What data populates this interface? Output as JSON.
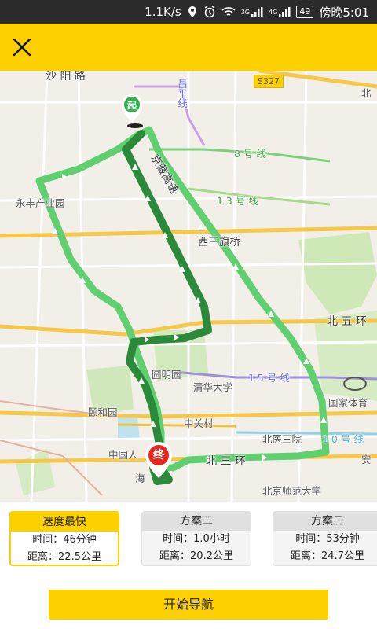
{
  "status_bar": {
    "net_speed": "1.1K/s",
    "battery": "49",
    "time": "傍晚5:01",
    "signal_a": "3G",
    "signal_b": "4G"
  },
  "header": {
    "close_icon": "close-icon"
  },
  "map": {
    "labels": {
      "shayang": "沙 阳 路",
      "s327": "S327",
      "changping": "昌平线",
      "line8": "8 号 线",
      "jingzang": "京藏高速",
      "line13": "1 3 号 线",
      "yongfeng": "永丰产业园",
      "xisanqi": "西三旗桥",
      "beiwuhuan": "北 五 环",
      "yuanmingyuan": "圆明园",
      "qinghua": "清华大学",
      "line15": "1 5 号 线",
      "yiheyuan": "颐和园",
      "guojiatiyu": "国家体育",
      "zhongguancun": "中关村",
      "beiyisanyuan": "北医三院",
      "line10": "1 0 号 线",
      "zhongguoren": "中国人",
      "beisanhuan": "北 三 环",
      "anzhen": "安",
      "haidian": "海",
      "bsd": "北京师范大学",
      "bei_top": "北"
    },
    "start_marker": "起",
    "end_marker": "终",
    "colors": {
      "route_selected": "#2a8a3a",
      "route_alt": "#5fcf70",
      "ring_road": "#f5c84a"
    }
  },
  "routes": [
    {
      "title": "速度最快",
      "time_label": "时间：",
      "time": "46分钟",
      "distance_label": "距离：",
      "distance": "22.5公里",
      "selected": true
    },
    {
      "title": "方案二",
      "time_label": "时间：",
      "time": "1.0小时",
      "distance_label": "距离：",
      "distance": "20.2公里",
      "selected": false
    },
    {
      "title": "方案三",
      "time_label": "时间：",
      "time": "53分钟",
      "distance_label": "距离：",
      "distance": "24.7公里",
      "selected": false
    }
  ],
  "actions": {
    "start_navigation": "开始导航"
  }
}
